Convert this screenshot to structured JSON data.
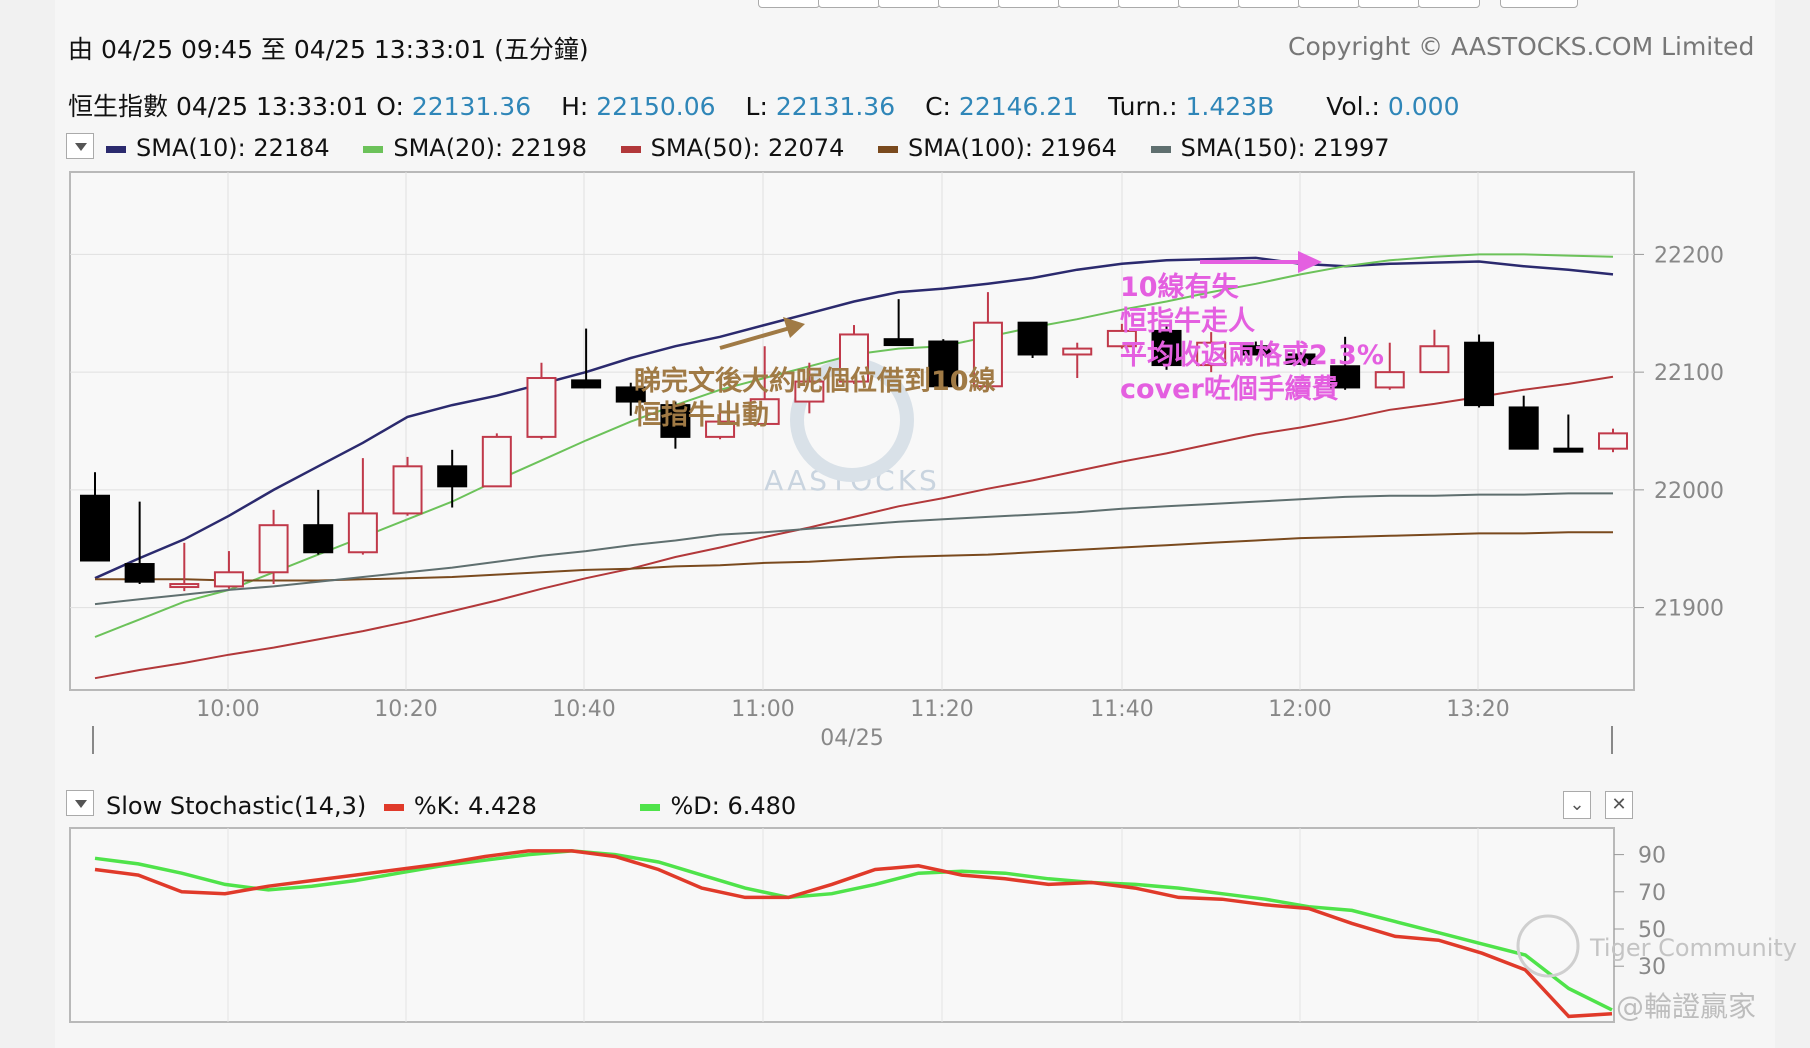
{
  "header": {
    "range_text": "由  04/25 09:45 至  04/25 13:33:01 (五分鐘)",
    "copyright": "Copyright © AASTOCKS.COM Limited",
    "quote": {
      "name": "恒生指數",
      "time": "04/25 13:33:01",
      "open_label": "O:",
      "open": "22131.36",
      "high_label": "H:",
      "high": "22150.06",
      "low_label": "L:",
      "low": "22131.36",
      "close_label": "C:",
      "close": "22146.21",
      "turn_label": "Turn.:",
      "turn": "1.423B",
      "vol_label": "Vol.:",
      "vol": "0.000"
    }
  },
  "sma_legend": [
    {
      "label": "SMA(10): 22184",
      "color": "#2b2a6e"
    },
    {
      "label": "SMA(20): 22198",
      "color": "#6cc25a"
    },
    {
      "label": "SMA(50): 22074",
      "color": "#b2383a"
    },
    {
      "label": "SMA(100): 21964",
      "color": "#7a4a1e"
    },
    {
      "label": "SMA(150): 21997",
      "color": "#5f6f6f"
    }
  ],
  "stoch_legend": {
    "title": "Slow Stochastic(14,3)",
    "k_label": "%K: 4.428",
    "k_color": "#e03a2a",
    "d_label": "%D: 6.480",
    "d_color": "#4fe34a"
  },
  "watermarks": {
    "center": "AASTOCKS",
    "community": "Tiger Community",
    "author": "@輪證贏家"
  },
  "chart_data": [
    {
      "type": "candlestick",
      "title": "",
      "date_label": "04/25",
      "x_tick_labels": [
        "10:00",
        "10:20",
        "10:40",
        "11:00",
        "11:20",
        "11:40",
        "12:00",
        "13:20"
      ],
      "y_tick_labels": [
        "22200",
        "22100",
        "22000",
        "21900"
      ],
      "ylim": [
        21830,
        22270
      ],
      "up_color": "#c0394a",
      "down_color": "#000000",
      "candles": [
        {
          "o": 21995,
          "h": 22015,
          "l": 21940,
          "c": 21940
        },
        {
          "o": 21937,
          "h": 21990,
          "l": 21920,
          "c": 21922
        },
        {
          "o": 21920,
          "h": 21955,
          "l": 21914,
          "c": 21920
        },
        {
          "o": 21918,
          "h": 21948,
          "l": 21916,
          "c": 21930
        },
        {
          "o": 21930,
          "h": 21983,
          "l": 21920,
          "c": 21970
        },
        {
          "o": 21970,
          "h": 22000,
          "l": 21945,
          "c": 21947
        },
        {
          "o": 21947,
          "h": 22027,
          "l": 21945,
          "c": 21980
        },
        {
          "o": 21980,
          "h": 22028,
          "l": 21978,
          "c": 22020
        },
        {
          "o": 22020,
          "h": 22034,
          "l": 21985,
          "c": 22003
        },
        {
          "o": 22003,
          "h": 22048,
          "l": 22003,
          "c": 22045
        },
        {
          "o": 22045,
          "h": 22108,
          "l": 22043,
          "c": 22095
        },
        {
          "o": 22093,
          "h": 22137,
          "l": 22092,
          "c": 22087
        },
        {
          "o": 22087,
          "h": 22091,
          "l": 22063,
          "c": 22075
        },
        {
          "o": 22072,
          "h": 22075,
          "l": 22035,
          "c": 22045
        },
        {
          "o": 22045,
          "h": 22065,
          "l": 22043,
          "c": 22058
        },
        {
          "o": 22056,
          "h": 22122,
          "l": 22055,
          "c": 22077
        },
        {
          "o": 22075,
          "h": 22108,
          "l": 22065,
          "c": 22092
        },
        {
          "o": 22092,
          "h": 22140,
          "l": 22090,
          "c": 22132
        },
        {
          "o": 22128,
          "h": 22162,
          "l": 22123,
          "c": 22123
        },
        {
          "o": 22126,
          "h": 22128,
          "l": 22085,
          "c": 22088
        },
        {
          "o": 22088,
          "h": 22168,
          "l": 22085,
          "c": 22142
        },
        {
          "o": 22142,
          "h": 22142,
          "l": 22112,
          "c": 22115
        },
        {
          "o": 22115,
          "h": 22125,
          "l": 22095,
          "c": 22120
        },
        {
          "o": 22122,
          "h": 22141,
          "l": 22120,
          "c": 22135
        },
        {
          "o": 22135,
          "h": 22139,
          "l": 22102,
          "c": 22106
        },
        {
          "o": 22106,
          "h": 22134,
          "l": 22100,
          "c": 22125
        },
        {
          "o": 22122,
          "h": 22126,
          "l": 22116,
          "c": 22115
        },
        {
          "o": 22115,
          "h": 22117,
          "l": 22107,
          "c": 22107
        },
        {
          "o": 22105,
          "h": 22130,
          "l": 22085,
          "c": 22087
        },
        {
          "o": 22087,
          "h": 22125,
          "l": 22085,
          "c": 22100
        },
        {
          "o": 22100,
          "h": 22136,
          "l": 22100,
          "c": 22122
        },
        {
          "o": 22125,
          "h": 22132,
          "l": 22070,
          "c": 22072
        },
        {
          "o": 22070,
          "h": 22080,
          "l": 22035,
          "c": 22035
        },
        {
          "o": 22035,
          "h": 22064,
          "l": 22032,
          "c": 22033
        },
        {
          "o": 22035,
          "h": 22052,
          "l": 22032,
          "c": 22048
        }
      ],
      "series": [
        {
          "name": "SMA(10)",
          "color": "#2b2a6e",
          "values": [
            21925,
            21942,
            21958,
            21978,
            22000,
            22020,
            22040,
            22062,
            22072,
            22080,
            22090,
            22100,
            22112,
            22122,
            22130,
            22140,
            22150,
            22160,
            22168,
            22171,
            22175,
            22180,
            22187,
            22192,
            22195,
            22196,
            22197,
            22192,
            22190,
            22192,
            22193,
            22194,
            22190,
            22187,
            22183
          ]
        },
        {
          "name": "SMA(20)",
          "color": "#6cc25a",
          "values": [
            21875,
            21890,
            21905,
            21915,
            21930,
            21945,
            21960,
            21975,
            21990,
            22008,
            22025,
            22042,
            22058,
            22072,
            22085,
            22095,
            22105,
            22115,
            22120,
            22122,
            22130,
            22138,
            22145,
            22153,
            22160,
            22168,
            22175,
            22183,
            22190,
            22195,
            22198,
            22200,
            22200,
            22199,
            22198
          ]
        },
        {
          "name": "SMA(50)",
          "color": "#b2383a",
          "values": [
            21840,
            21847,
            21853,
            21860,
            21866,
            21873,
            21880,
            21888,
            21897,
            21906,
            21916,
            21925,
            21933,
            21943,
            21951,
            21960,
            21968,
            21977,
            21986,
            21993,
            22001,
            22008,
            22016,
            22024,
            22031,
            22039,
            22047,
            22053,
            22060,
            22068,
            22073,
            22079,
            22085,
            22090,
            22096
          ]
        },
        {
          "name": "SMA(100)",
          "color": "#7a4a1e",
          "values": [
            21924,
            21924,
            21924,
            21923,
            21923,
            21923,
            21924,
            21925,
            21926,
            21928,
            21930,
            21932,
            21933,
            21935,
            21936,
            21938,
            21939,
            21941,
            21943,
            21944,
            21945,
            21947,
            21949,
            21951,
            21953,
            21955,
            21957,
            21959,
            21960,
            21961,
            21962,
            21963,
            21963,
            21964,
            21964
          ]
        },
        {
          "name": "SMA(150)",
          "color": "#5f6f6f",
          "values": [
            21903,
            21907,
            21911,
            21915,
            21918,
            21922,
            21926,
            21930,
            21934,
            21939,
            21944,
            21948,
            21953,
            21957,
            21962,
            21964,
            21967,
            21970,
            21973,
            21975,
            21977,
            21979,
            21981,
            21984,
            21986,
            21988,
            21990,
            21992,
            21994,
            21995,
            21995,
            21996,
            21996,
            21997,
            21997
          ]
        }
      ],
      "annotations": [
        {
          "lines": [
            "睇完文後大約呢個位借到10線",
            "恒指牛出動"
          ],
          "color": "#a07a45"
        },
        {
          "lines": [
            "10線有失",
            "恒指牛走人",
            "平均收返兩格或2.3%",
            "cover咗個手續費"
          ],
          "color": "#e45fe0"
        }
      ]
    },
    {
      "type": "line",
      "title": "Slow Stochastic(14,3)",
      "y_tick_labels": [
        "90",
        "70",
        "50",
        "30"
      ],
      "ylim": [
        0,
        100
      ],
      "series": [
        {
          "name": "%K",
          "color": "#e03a2a",
          "values": [
            82,
            79,
            70,
            69,
            73,
            76,
            79,
            82,
            85,
            89,
            92,
            92,
            89,
            82,
            72,
            67,
            67,
            74,
            82,
            84,
            79,
            77,
            74,
            75,
            72,
            67,
            66,
            63,
            61,
            53,
            46,
            44,
            37,
            28,
            3,
            4.4
          ]
        },
        {
          "name": "%D",
          "color": "#4fe34a",
          "values": [
            88,
            85,
            80,
            74,
            71,
            73,
            76,
            80,
            84,
            87,
            90,
            92,
            90,
            86,
            79,
            72,
            67,
            69,
            74,
            80,
            81,
            80,
            77,
            75,
            74,
            72,
            69,
            66,
            62,
            60,
            54,
            48,
            42,
            36,
            18,
            6.5
          ]
        }
      ]
    }
  ]
}
